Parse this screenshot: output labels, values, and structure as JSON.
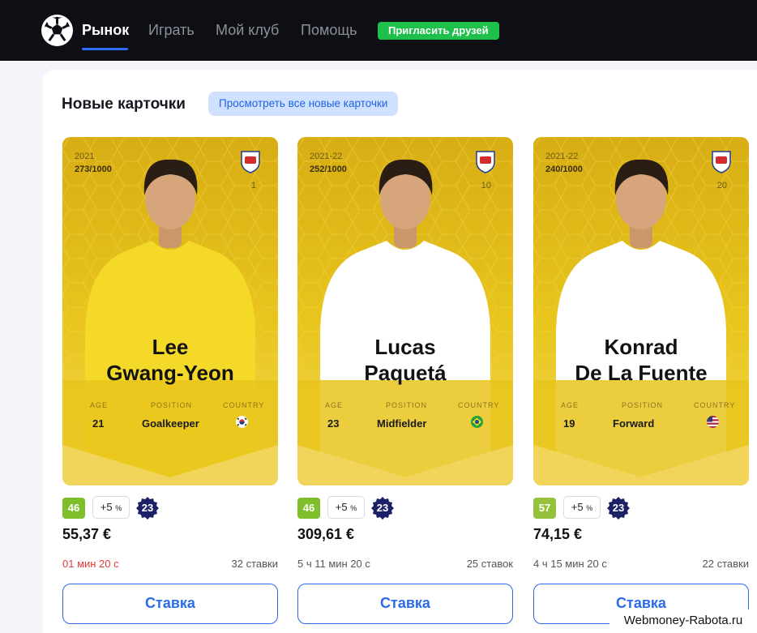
{
  "header": {
    "nav": [
      "Рынок",
      "Играть",
      "Мой клуб",
      "Помощь"
    ],
    "invite_label": "Пригласить друзей"
  },
  "section": {
    "title": "Новые карточки",
    "view_all_label": "Просмотреть все новые карточки"
  },
  "stat_labels": {
    "age": "AGE",
    "position": "POSITION",
    "country": "COUNTRY"
  },
  "cards": [
    {
      "season": "2021",
      "serial": "273/1000",
      "jersey": "1",
      "name_line1": "Lee",
      "name_line2": "Gwang-Yeon",
      "age": "21",
      "position": "Goalkeeper",
      "country_icon": "south-korea-flag-icon",
      "score": "46",
      "score_color": "#7fbf2c",
      "bonus": "+5",
      "bonus_unit": "%",
      "gameweek": "23",
      "price": "55,37 €",
      "time_left": "01 мин 20 с",
      "time_urgent": true,
      "bids": "32 ставки",
      "bid_label": "Ставка",
      "shirt_color": "#f4d928"
    },
    {
      "season": "2021-22",
      "serial": "252/1000",
      "jersey": "10",
      "name_line1": "Lucas",
      "name_line2": "Paquetá",
      "age": "23",
      "position": "Midfielder",
      "country_icon": "brazil-flag-icon",
      "score": "46",
      "score_color": "#7fbf2c",
      "bonus": "+5",
      "bonus_unit": "%",
      "gameweek": "23",
      "price": "309,61 €",
      "time_left": "5 ч 11 мин 20 с",
      "time_urgent": false,
      "bids": "25 ставок",
      "bid_label": "Ставка",
      "shirt_color": "#ffffff"
    },
    {
      "season": "2021-22",
      "serial": "240/1000",
      "jersey": "20",
      "name_line1": "Konrad",
      "name_line2": "De La Fuente",
      "age": "19",
      "position": "Forward",
      "country_icon": "usa-flag-icon",
      "score": "57",
      "score_color": "#95c23a",
      "bonus": "+5",
      "bonus_unit": "%",
      "gameweek": "23",
      "price": "74,15 €",
      "time_left": "4 ч 15 мин 20 с",
      "time_urgent": false,
      "bids": "22 ставки",
      "bid_label": "Ставка",
      "shirt_color": "#ffffff"
    }
  ],
  "watermark": "Webmoney-Rabota.ru",
  "colors": {
    "accent": "#2b6ae8",
    "invite": "#1fbf4b",
    "topbar": "#0e0f14",
    "card_gold": "#e8c419",
    "gameweek_badge": "#1b2166"
  }
}
